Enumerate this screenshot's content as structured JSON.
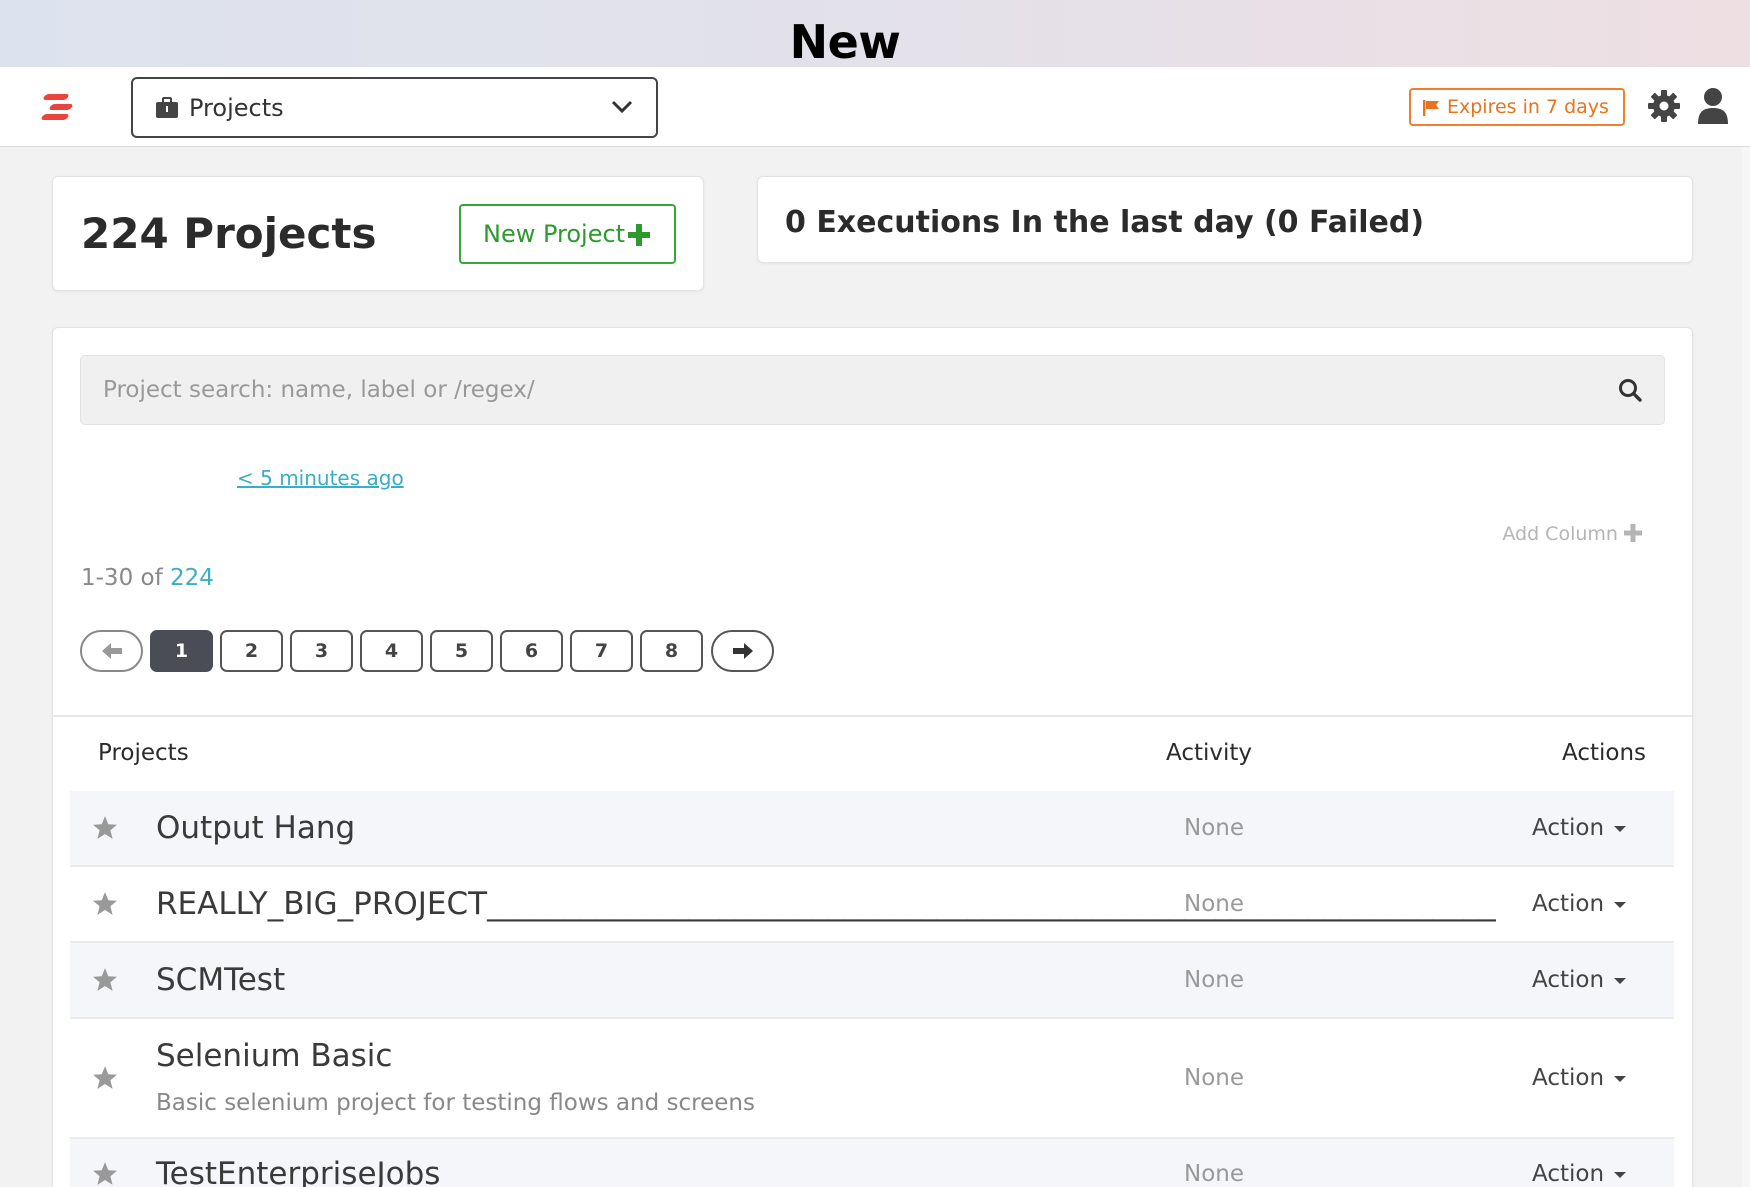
{
  "banner": {
    "title": "New"
  },
  "navbar": {
    "project_select": "Projects",
    "expires": "Expires in 7 days"
  },
  "summary": {
    "count_label": "224 Projects",
    "new_project_label": "New Project",
    "executions": "0 Executions In the last day (0 Failed)"
  },
  "search": {
    "placeholder": "Project search: name, label or /regex/"
  },
  "recent_link": "< 5 minutes ago",
  "add_column": "Add Column",
  "range": {
    "label": "1-30 of",
    "total": "224"
  },
  "pager": [
    "1",
    "2",
    "3",
    "4",
    "5",
    "6",
    "7",
    "8"
  ],
  "table": {
    "headers": {
      "projects": "Projects",
      "activity": "Activity",
      "actions": "Actions"
    },
    "rows": [
      {
        "name": "Output Hang",
        "description": "",
        "activity": "None",
        "action": "Action"
      },
      {
        "name": "REALLY_BIG_PROJECT____________________________________________________________________",
        "description": "",
        "activity": "None",
        "action": "Action"
      },
      {
        "name": "SCMTest",
        "description": "",
        "activity": "None",
        "action": "Action"
      },
      {
        "name": "Selenium Basic",
        "description": "Basic selenium project for testing flows and screens",
        "activity": "None",
        "action": "Action"
      },
      {
        "name": "TestEnterpriseJobs",
        "description": "",
        "activity": "None",
        "action": "Action"
      }
    ]
  },
  "colors": {
    "brand": "#e8453c",
    "warning": "#f07f2e",
    "success": "#3aa53a",
    "link": "#3cadc7",
    "active_page": "#4a4d55"
  }
}
